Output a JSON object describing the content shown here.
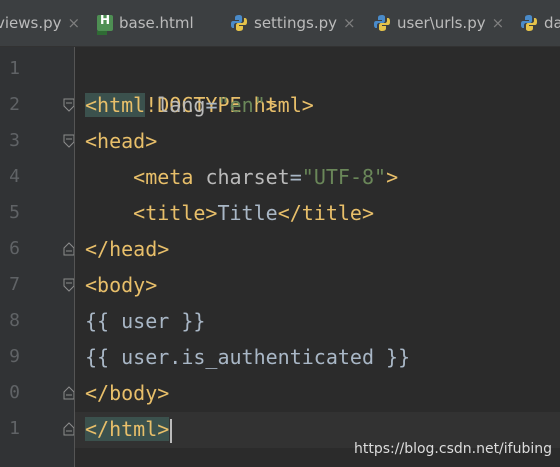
{
  "tabs": [
    {
      "label": "views.py",
      "icon": "python-file-icon",
      "closable": true
    },
    {
      "label": "base.html",
      "icon": "html-file-icon",
      "closable": false
    },
    {
      "label": "settings.py",
      "icon": "python-file-icon",
      "closable": true
    },
    {
      "label": "user\\urls.py",
      "icon": "python-file-icon",
      "closable": true
    },
    {
      "label": "da",
      "icon": "python-file-icon",
      "closable": false
    }
  ],
  "close_glyph": "×",
  "line_numbers": [
    "1",
    "2",
    "3",
    "4",
    "5",
    "6",
    "7",
    "8",
    "9",
    "0",
    "1"
  ],
  "code": {
    "l1": "<!DOCTYPE html>",
    "l2_open": "<html",
    "l2_attr": "lang",
    "l2_eq": "=",
    "l2_val": "\"en\"",
    "l2_close": ">",
    "l3": "<head>",
    "l4_open": "<meta",
    "l4_attr": "charset",
    "l4_eq": "=",
    "l4_val": "\"UTF-8\"",
    "l4_close": ">",
    "l5_open": "<title>",
    "l5_text": "Title",
    "l5_close": "</title>",
    "l6": "</head>",
    "l7": "<body>",
    "l8": "{{ user }}",
    "l9": "{{ user.is_authenticated }}",
    "l10": "</body>",
    "l11": "</html>"
  },
  "watermark": "https://blog.csdn.net/ifubing",
  "colors": {
    "background": "#2b2b2b",
    "tag": "#e8bf6a",
    "string": "#6a8759",
    "text": "#a9b7c6",
    "match_highlight": "#3b514d"
  }
}
